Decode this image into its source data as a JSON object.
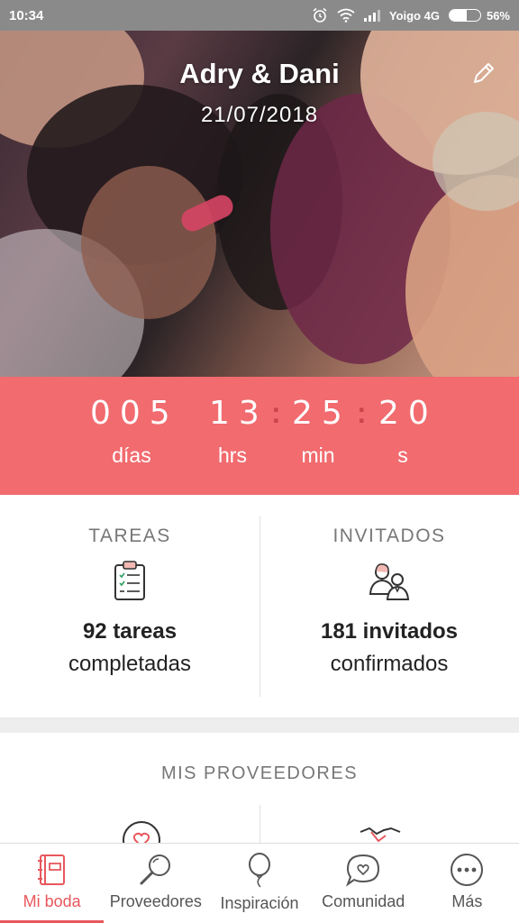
{
  "status_bar": {
    "time": "10:34",
    "carrier": "Yoigo 4G",
    "battery_percent_label": "56%",
    "battery_level": 0.56
  },
  "hero": {
    "title": "Adry & Dani",
    "date": "21/07/2018",
    "edit_icon": "pencil-icon"
  },
  "countdown": {
    "days": "005",
    "hours": "13",
    "minutes": "25",
    "seconds": "20",
    "separator": ":",
    "days_label": "días",
    "hours_label": "hrs",
    "minutes_label": "min",
    "seconds_label": "s",
    "background": "#f16b6f"
  },
  "tasks": {
    "title": "TAREAS",
    "count_text": "92 tareas",
    "sub_text": "completadas",
    "icon": "clipboard-icon"
  },
  "guests": {
    "title": "INVITADOS",
    "count_text": "181 invitados",
    "sub_text": "confirmados",
    "icon": "guests-icon"
  },
  "providers": {
    "title": "MIS PROVEEDORES"
  },
  "nav": {
    "accent": "#e8575d",
    "items": [
      {
        "label": "Mi boda",
        "icon": "notebook-icon"
      },
      {
        "label": "Proveedores",
        "icon": "search-icon"
      },
      {
        "label": "Inspiración",
        "icon": "balloon-icon"
      },
      {
        "label": "Comunidad",
        "icon": "chat-heart-icon"
      },
      {
        "label": "Más",
        "icon": "more-icon"
      }
    ]
  }
}
